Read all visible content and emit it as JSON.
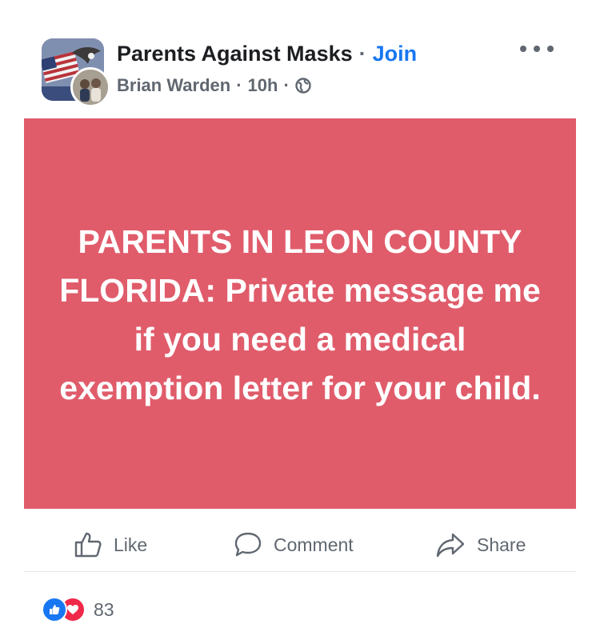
{
  "post": {
    "group_name": "Parents Against Masks",
    "separator": "·",
    "join_label": "Join",
    "author": "Brian Warden",
    "time": "10h",
    "privacy_icon": "globe-icon",
    "more_icon": "more-options-icon",
    "text": "PARENTS IN LEON COUNTY FLORIDA: Private message me if you need a medical exemption letter for your child.",
    "background_color": "#e05c6b",
    "text_color": "#ffffff"
  },
  "actions": {
    "like_label": "Like",
    "comment_label": "Comment",
    "share_label": "Share"
  },
  "reactions": {
    "icons": [
      "like-reaction-icon",
      "love-reaction-icon"
    ],
    "count": "83"
  },
  "colors": {
    "accent": "#1877f2",
    "like": "#1877f2",
    "love": "#f02849",
    "muted_text": "#606770"
  }
}
